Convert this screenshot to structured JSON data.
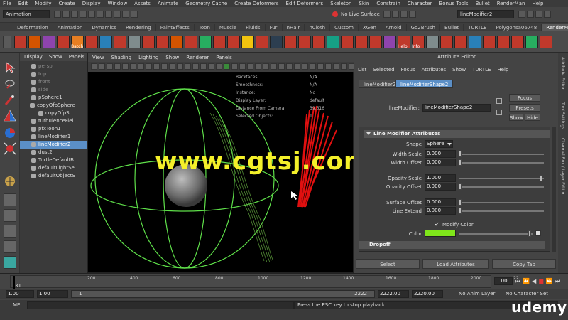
{
  "menubar": [
    "File",
    "Edit",
    "Modify",
    "Create",
    "Display",
    "Window",
    "Assets",
    "Animate",
    "Geometry Cache",
    "Create Deformers",
    "Edit Deformers",
    "Skeleton",
    "Skin",
    "Constrain",
    "Character",
    "Bonus Tools",
    "Bullet",
    "RenderMan",
    "Help"
  ],
  "status": {
    "mode": "Animation",
    "live_surface": "No Live Surface",
    "search_value": "lineModifier2"
  },
  "shelf_tabs": [
    "Deformation",
    "Animation",
    "Dynamics",
    "Rendering",
    "PaintEffects",
    "Toon",
    "Muscle",
    "Fluids",
    "Fur",
    "nHair",
    "nCloth",
    "Custom",
    "XGen",
    "Arnold",
    "Go2Brush",
    "Bullet",
    "TURTLE",
    "Polygonsa06748",
    "RenderMan"
  ],
  "shelf_labels": {
    "batch": "Batch",
    "help": "Help",
    "info": "Info"
  },
  "outliner": {
    "menu": [
      "Display",
      "Show",
      "Panels"
    ],
    "items": [
      {
        "label": "persp",
        "dim": true
      },
      {
        "label": "top",
        "dim": true
      },
      {
        "label": "front",
        "dim": true
      },
      {
        "label": "side",
        "dim": true
      },
      {
        "label": "pSphere1",
        "dim": false
      },
      {
        "label": "copyOfpSphere",
        "dim": false
      },
      {
        "label": "copyOfpS",
        "dim": false
      },
      {
        "label": "turbulenceFiel",
        "dim": false
      },
      {
        "label": "pfxToon1",
        "dim": false
      },
      {
        "label": "lineModifier1",
        "dim": false
      },
      {
        "label": "lineModifier2",
        "dim": false
      },
      {
        "label": "dust2",
        "dim": false
      },
      {
        "label": "TurtleDefaultB",
        "dim": false
      },
      {
        "label": "defaultLightSe",
        "dim": false
      },
      {
        "label": "defaultObjectS",
        "dim": false
      }
    ]
  },
  "viewport": {
    "menu": [
      "View",
      "Shading",
      "Lighting",
      "Show",
      "Renderer",
      "Panels"
    ],
    "hud": [
      {
        "label": "Backfaces:",
        "value": "N/A"
      },
      {
        "label": "Smoothness:",
        "value": "N/A"
      },
      {
        "label": "Instance:",
        "value": "No"
      },
      {
        "label": "Display Layer:",
        "value": "default"
      },
      {
        "label": "Distance From Camera:",
        "value": "39.616"
      },
      {
        "label": "Selected Objects:",
        "value": "1"
      }
    ],
    "watermark": "www.cgtsj.com"
  },
  "attr": {
    "title": "Attribute Editor",
    "menu": [
      "List",
      "Selected",
      "Focus",
      "Attributes",
      "Show",
      "TURTLE",
      "Help"
    ],
    "tabs": [
      "lineModifier2",
      "lineModifierShape2"
    ],
    "node_label": "lineModifier:",
    "node_value": "lineModifierShape2",
    "focus": "Focus",
    "presets": "Presets",
    "show": "Show",
    "hide": "Hide",
    "section1": "Line Modifier Attributes",
    "shape_label": "Shape",
    "shape_value": "Sphere",
    "rows": [
      {
        "label": "Width Scale",
        "value": "0.000"
      },
      {
        "label": "Width Offset",
        "value": "0.000"
      },
      {
        "label": "Opacity Scale",
        "value": "1.000"
      },
      {
        "label": "Opacity Offset",
        "value": "0.000"
      },
      {
        "label": "Surface Offset",
        "value": "0.000"
      },
      {
        "label": "Line Extend",
        "value": "0.000"
      }
    ],
    "modify_color": "Modify Color",
    "color_label": "Color",
    "section2": "Dropoff",
    "select": "Select",
    "load": "Load Attributes",
    "copy": "Copy Tab"
  },
  "right_strip": [
    "Attribute Editor",
    "Tool Settings",
    "Channel Box / Layer Editor"
  ],
  "timeline": {
    "ticks": [
      "200",
      "400",
      "600",
      "800",
      "1000",
      "1200",
      "1400",
      "1600",
      "1800",
      "2000",
      "22"
    ],
    "current_frame": "31",
    "frame_field": "1.00"
  },
  "range": {
    "start": "1.00",
    "start2": "1.00",
    "range_start": "1",
    "range_end": "2222",
    "end": "2222.00",
    "end2": "2220.00",
    "anim_layer": "No Anim Layer",
    "character": "No Character Set"
  },
  "cmdline": {
    "label": "MEL",
    "message": "Press the ESC key to stop playback."
  },
  "brand": "udemy",
  "colors": {
    "selection": "#5b8fc7",
    "modify_color": "#7fe51a",
    "watermark": "#f4f02a"
  }
}
